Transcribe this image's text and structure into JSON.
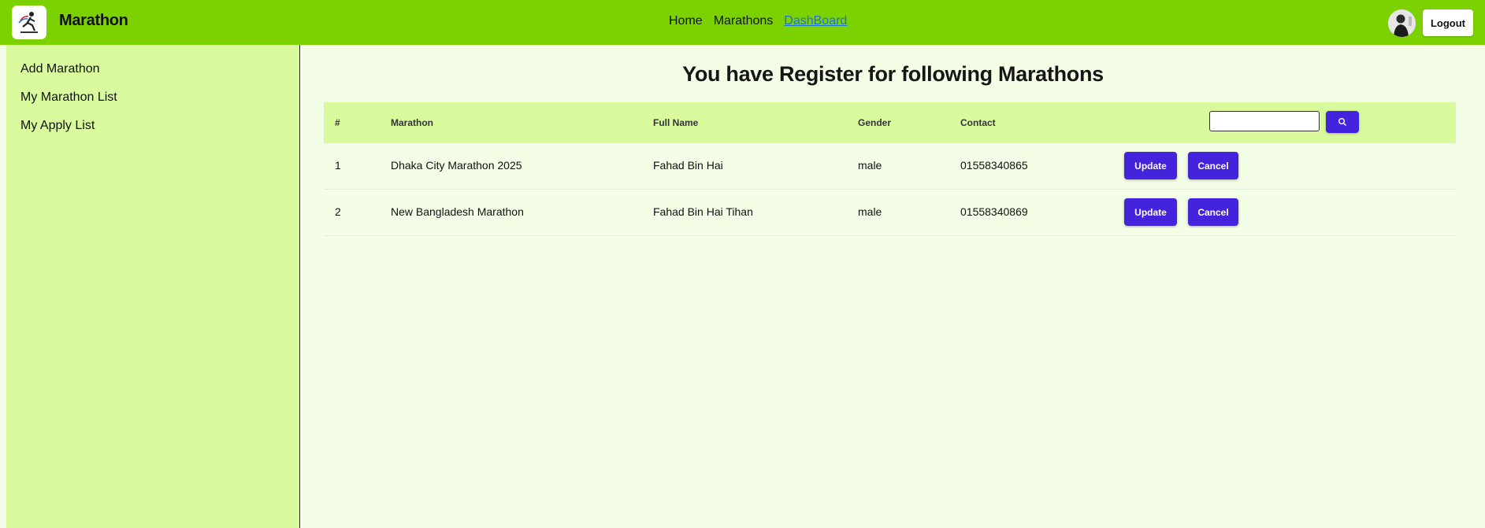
{
  "brand": {
    "name": "Marathon"
  },
  "nav": {
    "links": [
      {
        "label": "Home"
      },
      {
        "label": "Marathons"
      },
      {
        "label": "DashBoard"
      }
    ],
    "logout_label": "Logout"
  },
  "sidebar": {
    "items": [
      {
        "label": "Add Marathon"
      },
      {
        "label": "My Marathon List"
      },
      {
        "label": "My Apply List"
      }
    ]
  },
  "main": {
    "title": "You have Register for following Marathons",
    "table": {
      "headers": [
        "#",
        "Marathon",
        "Full Name",
        "Gender",
        "Contact"
      ],
      "search": {
        "value": "",
        "placeholder": ""
      },
      "update_label": "Update",
      "cancel_label": "Cancel",
      "rows": [
        {
          "index": "1",
          "marathon": "Dhaka City Marathon 2025",
          "full_name": "Fahad Bin Hai",
          "gender": "male",
          "contact": "01558340865"
        },
        {
          "index": "2",
          "marathon": "New Bangladesh Marathon",
          "full_name": "Fahad Bin Hai Tihan",
          "gender": "male",
          "contact": "01558340869"
        }
      ]
    }
  },
  "colors": {
    "navbar": "#7cd200",
    "sidebar": "#dafa9e",
    "main_bg": "#f4fee6",
    "accent_button": "#4323dc",
    "active_link": "#1f6fd8"
  },
  "icons": {
    "logo": "marathon-runner-logo",
    "search": "search-icon",
    "avatar": "user-avatar"
  }
}
